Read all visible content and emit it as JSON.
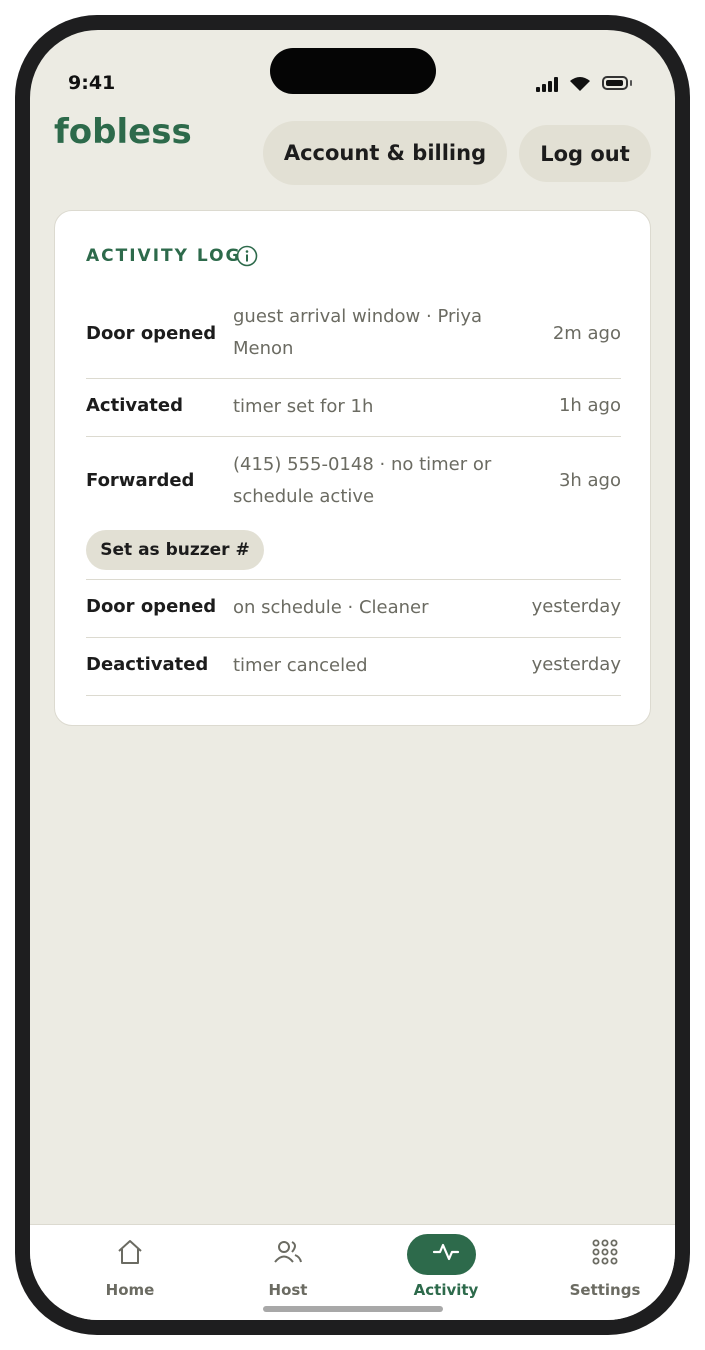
{
  "status_bar": {
    "time": "9:41"
  },
  "header": {
    "logo": "fobless",
    "account_button": "Account & billing",
    "logout_button": "Log out"
  },
  "activity_log": {
    "title": "ACTIVITY LOG",
    "entries": [
      {
        "event": "Door opened",
        "detail": "guest arrival window · Priya Menon",
        "time": "2m ago"
      },
      {
        "event": "Activated",
        "detail": "timer set for 1h",
        "time": "1h ago"
      },
      {
        "event": "Forwarded",
        "detail": "(415) 555-0148 · no timer or schedule active",
        "time": "3h ago",
        "action": "Set as buzzer #"
      },
      {
        "event": "Door opened",
        "detail": "on schedule · Cleaner",
        "time": "yesterday"
      },
      {
        "event": "Deactivated",
        "detail": "timer canceled",
        "time": "yesterday"
      }
    ]
  },
  "tabbar": {
    "tabs": [
      {
        "label": "Home",
        "icon": "home-icon"
      },
      {
        "label": "Host",
        "icon": "people-icon"
      },
      {
        "label": "Activity",
        "icon": "pulse-icon",
        "active": true
      },
      {
        "label": "Settings",
        "icon": "grid-icon"
      }
    ]
  },
  "colors": {
    "accent": "#2d6a4b",
    "background": "#ecebe3",
    "pill": "#e2e0d4"
  }
}
